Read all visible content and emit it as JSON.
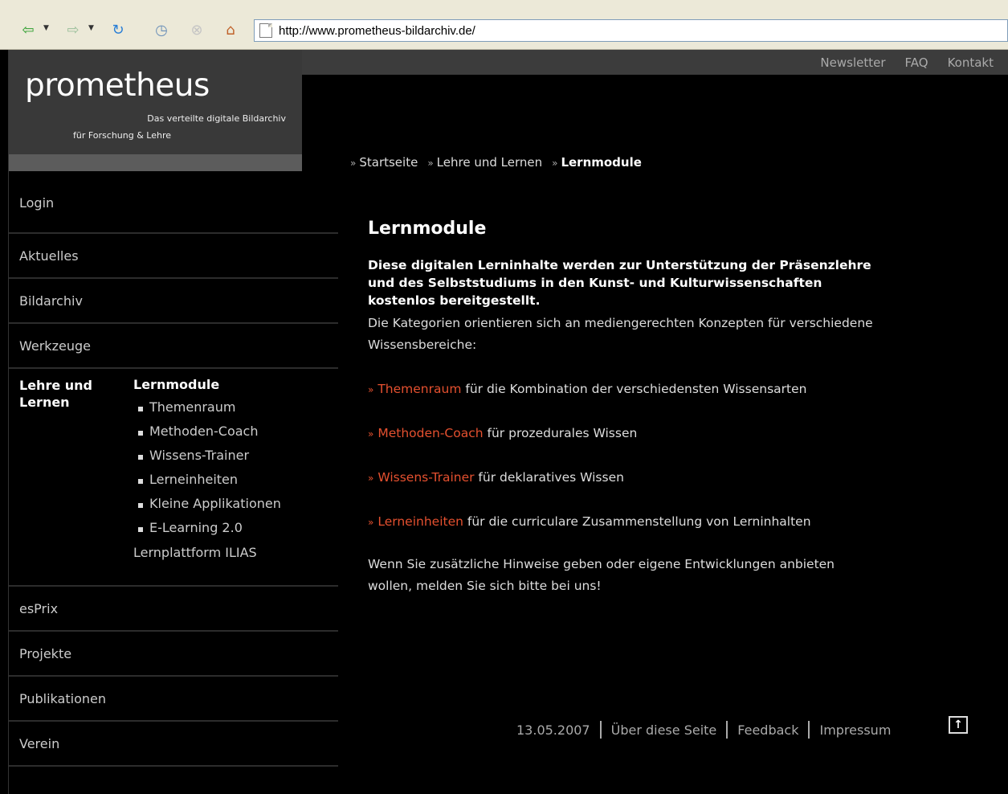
{
  "browser": {
    "url": "http://www.prometheus-bildarchiv.de/"
  },
  "logo": {
    "word": "prometheus",
    "sub_line1": "Das verteilte digitale Bildarchiv",
    "sub_line2": "für Forschung & Lehre"
  },
  "toplinks": [
    "Newsletter",
    "FAQ",
    "Kontakt"
  ],
  "breadcrumb": {
    "items": [
      "Startseite",
      "Lehre und Lernen"
    ],
    "current": "Lernmodule"
  },
  "nav": {
    "items": [
      "Login",
      "Aktuelles",
      "Bildarchiv",
      "Werkzeuge"
    ],
    "active": "Lehre und Lernen",
    "sub_head": "Lernmodule",
    "sub_items": [
      "Themenraum",
      "Methoden-Coach",
      "Wissens-Trainer",
      "Lerneinheiten",
      "Kleine Applikationen",
      "E-Learning 2.0"
    ],
    "sub_tail": "Lernplattform ILIAS",
    "items_after": [
      "esPrix",
      "Projekte",
      "Publikationen",
      "Verein"
    ]
  },
  "main": {
    "title": "Lernmodule",
    "intro": "Diese digitalen Lerninhalte werden zur Unterstützung der Präsenzlehre und des Selbststudiums in den Kunst- und Kulturwissenschaften kostenlos bereitgestellt.",
    "para": "Die Kategorien orientieren sich an mediengerechten Konzepten für verschiedene Wissensbereiche:",
    "links": [
      {
        "link": "Themenraum",
        "text": " für die Kombination der verschiedensten Wissensarten"
      },
      {
        "link": "Methoden-Coach",
        "text": " für prozedurales Wissen"
      },
      {
        "link": "Wissens-Trainer",
        "text": " für deklaratives Wissen"
      },
      {
        "link": "Lerneinheiten",
        "text": " für die curriculare Zusammenstellung von Lerninhalten"
      }
    ],
    "outro": "Wenn Sie zusätzliche Hinweise geben oder eigene Entwicklungen anbieten wollen, melden Sie sich bitte bei uns!"
  },
  "footer": {
    "date": "13.05.2007",
    "about": "Über diese Seite",
    "feedback": "Feedback",
    "impressum": "Impressum"
  },
  "colors": {
    "link_accent": "#e4502f",
    "background": "#000000",
    "logo_bg": "#393939"
  }
}
